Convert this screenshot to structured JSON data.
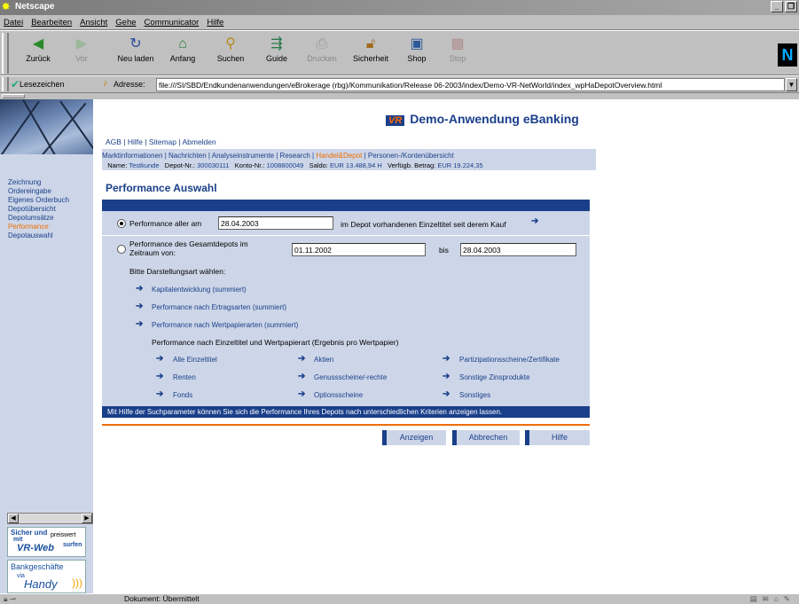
{
  "window": {
    "title": "Netscape"
  },
  "menu": [
    "Datei",
    "Bearbeiten",
    "Ansicht",
    "Gehe",
    "Communicator",
    "Hilfe"
  ],
  "toolbar": [
    {
      "label": "Zurück",
      "icon": "back-icon",
      "disabled": false
    },
    {
      "label": "Vor",
      "icon": "forward-icon",
      "disabled": true
    },
    {
      "label": "Neu laden",
      "icon": "reload-icon",
      "disabled": false
    },
    {
      "label": "Anfang",
      "icon": "home-icon",
      "disabled": false
    },
    {
      "label": "Suchen",
      "icon": "search-icon",
      "disabled": false
    },
    {
      "label": "Guide",
      "icon": "guide-icon",
      "disabled": false
    },
    {
      "label": "Drucken",
      "icon": "print-icon",
      "disabled": true
    },
    {
      "label": "Sicherheit",
      "icon": "lock-icon",
      "disabled": false
    },
    {
      "label": "Shop",
      "icon": "shop-icon",
      "disabled": false
    },
    {
      "label": "Stop",
      "icon": "stop-icon",
      "disabled": true
    }
  ],
  "location": {
    "bookmarks_label": "Lesezeichen",
    "address_label": "Adresse:",
    "url": "file:///SI/SBD/Endkundenanwendungen/eBrokerage (rbg)/Kommunikation/Release 06-2003/index/Demo-VR-NetWorld/index_wpHaDepotOverview.html"
  },
  "sidebar": {
    "items": [
      {
        "label": "Zeichnung",
        "active": false
      },
      {
        "label": "Ordereingabe",
        "active": false
      },
      {
        "label": "Eigenes Orderbuch",
        "active": false
      },
      {
        "label": "Depotübersicht",
        "active": false
      },
      {
        "label": "Depotumsätze",
        "active": false
      },
      {
        "label": "Performance",
        "active": true
      },
      {
        "label": "Depotauswahl",
        "active": false
      }
    ],
    "ad1": {
      "line1": "Sicher und",
      "line2": "preiswert",
      "line3": "mit",
      "line4": "VR-Web",
      "line5": "surfen"
    },
    "ad2": {
      "line1": "Bankgeschäfte",
      "line2": "via",
      "line3": "Handy"
    }
  },
  "header": {
    "brand": "Demo-Anwendung eBanking",
    "toplinks": "AGB | Hilfe | Sitemap | Abmelden",
    "nav_before": "Marktinformationen | Nachrichten | Analyseinstrumente | Research | ",
    "nav_active": "Handel&Depot",
    "nav_after": " | Personen-/Kontenübersicht",
    "info": {
      "name_label": "Name:",
      "name": "Testkunde",
      "depot_label": "Depot-Nr.:",
      "depot": "300030111",
      "konto_label": "Konto-Nr.:",
      "konto": "1008800049",
      "saldo_label": "Saldo:",
      "saldo": "EUR 13.488,94 H",
      "verf_label": "Verfügb. Betrag:",
      "verf": "EUR 19.224,35"
    }
  },
  "page": {
    "title": "Performance Auswahl",
    "option1": {
      "label": "Performance aller am",
      "date": "28.04.2003",
      "suffix": "im Depot vorhandenen Einzeltitel seit derem Kauf"
    },
    "option2": {
      "label_line1": "Performance des Gesamtdepots im",
      "label_line2": "Zeitraum von:",
      "from": "01.11.2002",
      "bis_label": "bis",
      "to": "28.04.2003"
    },
    "choose_label": "Bitte Darstellungsart wählen:",
    "summary_links": [
      "Kapitalentwicklung (summiert)",
      "Performance nach Ertragsarten (summiert)",
      "Performance nach Wertpapierarten (summiert)"
    ],
    "einzel_heading": "Performance nach Einzeltitel und Wertpapierart (Ergebnis pro Wertpapier)",
    "grid_links": [
      [
        "Alle Einzeltitel",
        "Aktien",
        "Partizipationsscheine/Zertifikate"
      ],
      [
        "Renten",
        "Genussscheine/-rechte",
        "Sonstige Zinsprodukte"
      ],
      [
        "Fonds",
        "Optionsscheine",
        "Sonstiges"
      ]
    ],
    "help_text": "Mit Hilfe der Suchparameter können Sie sich die Performance Ihres Depots nach unterschiedlichen Kriterien anzeigen lassen.",
    "buttons": {
      "show": "Anzeigen",
      "cancel": "Abbrechen",
      "help": "Hilfe"
    }
  },
  "status": {
    "text": "Dokument: Übermittelt"
  },
  "colors": {
    "navy": "#1a3f8a",
    "light_blue": "#cdd6e8",
    "orange": "#f06e00"
  }
}
